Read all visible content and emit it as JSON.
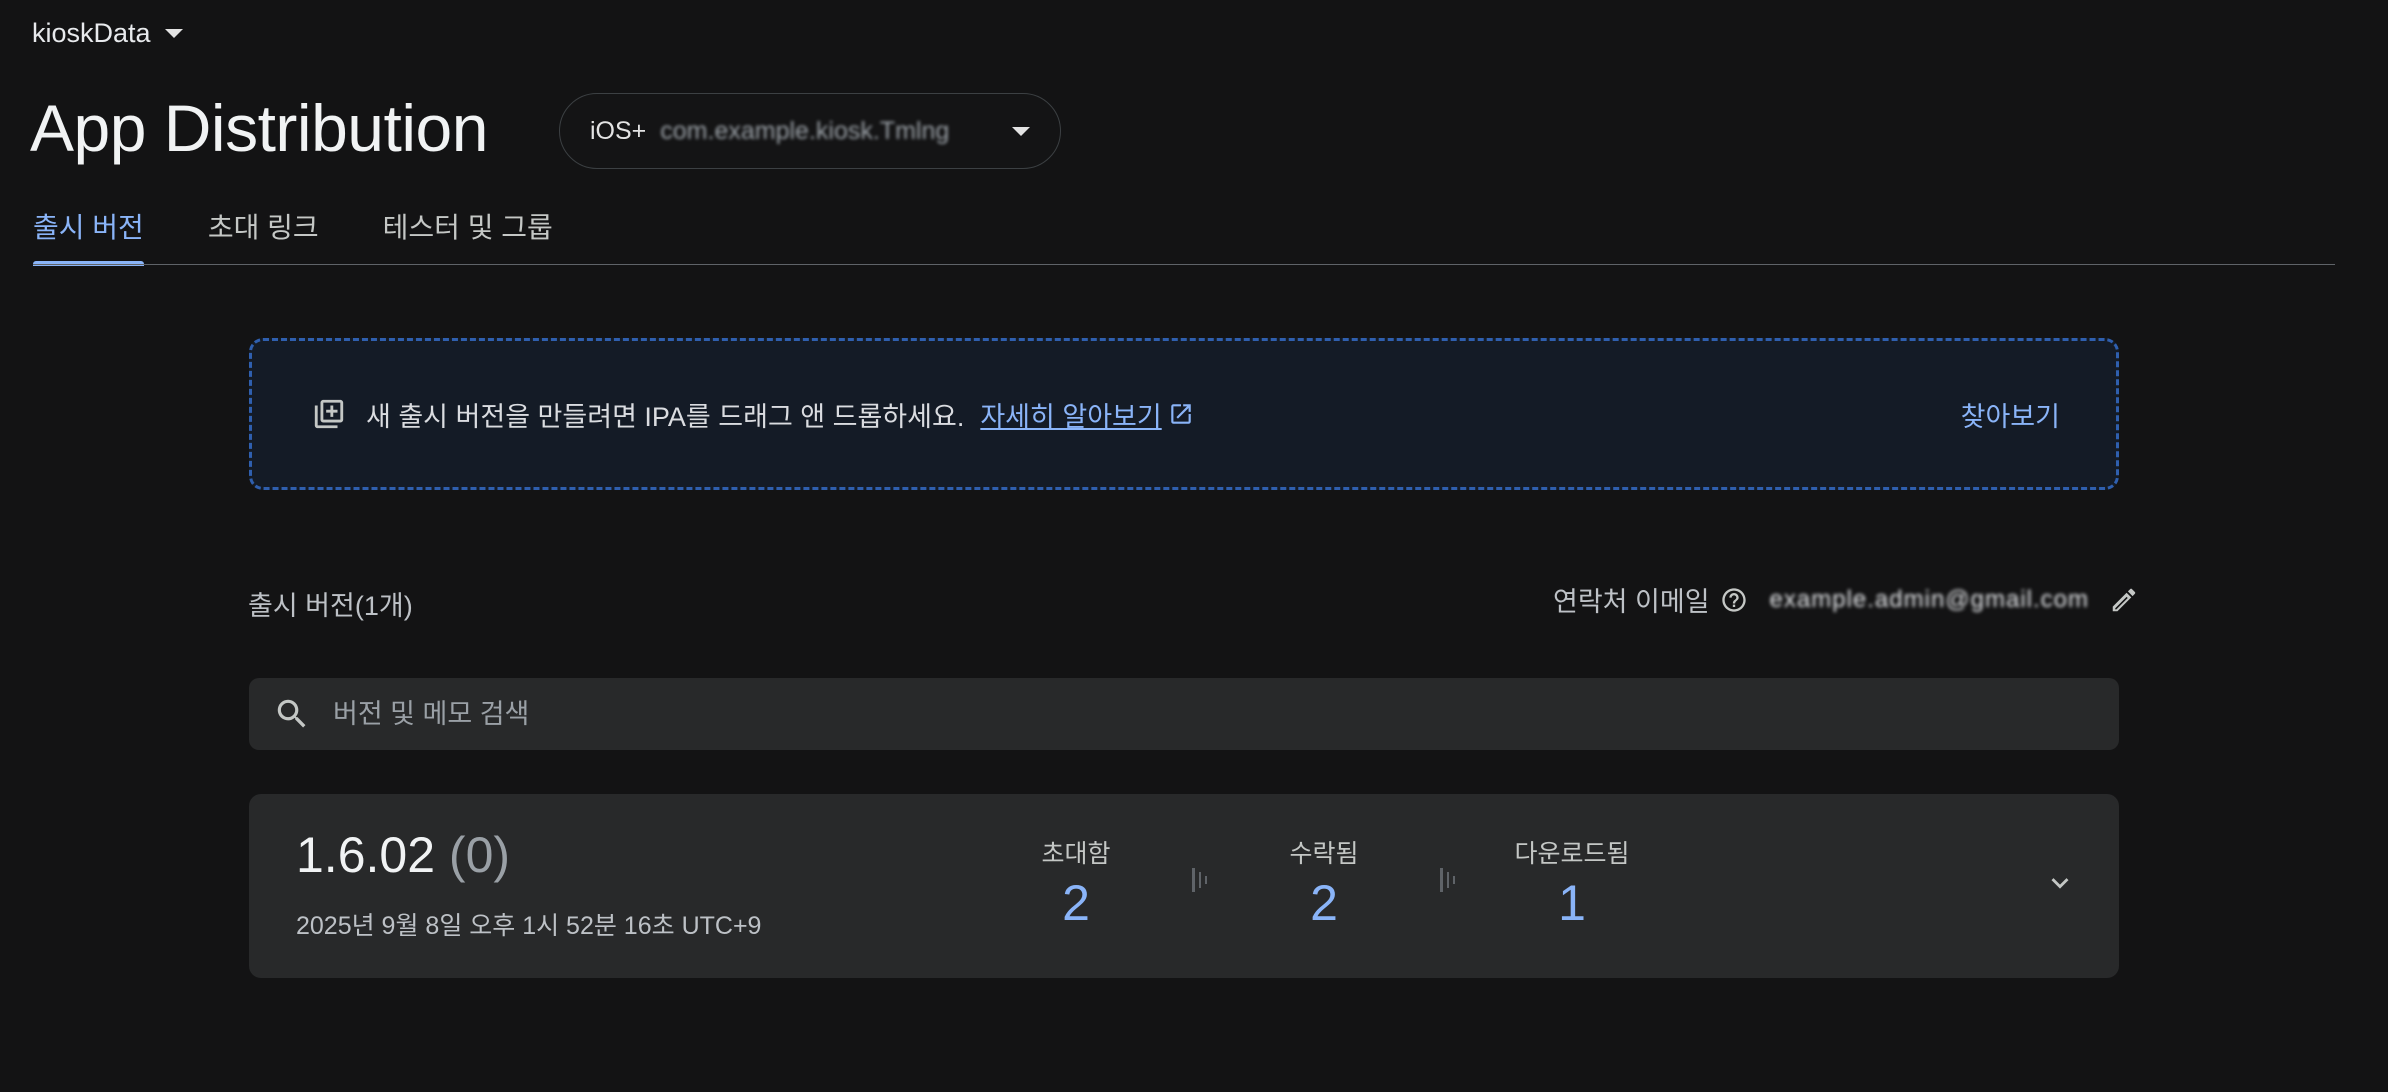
{
  "project": {
    "name": "kioskData",
    "icon": "chevron-down-icon"
  },
  "page": {
    "title": "App Distribution"
  },
  "app_selector": {
    "platform": "iOS+",
    "bundle": "com.example.kiosk.Tmlng"
  },
  "tabs": [
    {
      "label": "출시 버전",
      "active": true
    },
    {
      "label": "초대 링크",
      "active": false
    },
    {
      "label": "테스터 및 그룹",
      "active": false
    }
  ],
  "dropzone": {
    "text": "새 출시 버전을 만들려면 IPA를 드래그 앤 드롭하세요.",
    "learn_more": "자세히 알아보기",
    "browse": "찾아보기",
    "border_color": "#2f5fae"
  },
  "releases": {
    "count_label": "출시 버전(1개)",
    "contact_label": "연락처 이메일",
    "contact_email": "example.admin@gmail.com"
  },
  "search": {
    "placeholder": "버전 및 메모 검색"
  },
  "release": {
    "version": "1.6.02",
    "build": "(0)",
    "date": "2025년 9월 8일 오후 1시 52분 16초 UTC+9",
    "stats": [
      {
        "label": "초대함",
        "value": "2"
      },
      {
        "label": "수락됨",
        "value": "2"
      },
      {
        "label": "다운로드됨",
        "value": "1"
      }
    ]
  },
  "colors": {
    "accent": "#8ab4f8",
    "background": "#131314",
    "surface": "#28292a"
  }
}
